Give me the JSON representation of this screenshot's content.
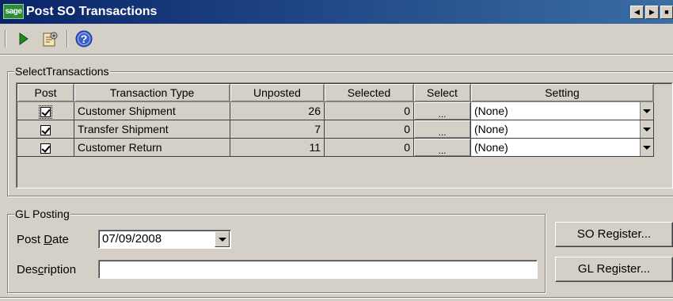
{
  "window": {
    "title": "Post SO Transactions",
    "logo": "sage",
    "controls": [
      "minimize",
      "maximize",
      "close"
    ]
  },
  "toolbar": {
    "items": [
      {
        "name": "run",
        "icon": "play-icon"
      },
      {
        "name": "setup",
        "icon": "setup-icon"
      },
      {
        "name": "help",
        "icon": "help-icon"
      }
    ]
  },
  "select_transactions": {
    "legend": "SelectTransactions",
    "columns": [
      "Post",
      "Transaction Type",
      "Unposted",
      "Selected",
      "Select",
      "Setting"
    ],
    "rows": [
      {
        "post": true,
        "type": "Customer Shipment",
        "unposted": "26",
        "selected": "0",
        "select": "...",
        "setting": "(None)"
      },
      {
        "post": true,
        "type": "Transfer Shipment",
        "unposted": "7",
        "selected": "0",
        "select": "...",
        "setting": "(None)"
      },
      {
        "post": true,
        "type": "Customer Return",
        "unposted": "11",
        "selected": "0",
        "select": "...",
        "setting": "(None)"
      }
    ]
  },
  "gl_posting": {
    "legend": "GL Posting",
    "post_date_label_pre": "Post ",
    "post_date_label_u": "D",
    "post_date_label_post": "ate",
    "post_date_value": "07/09/2008",
    "description_label_pre": "Des",
    "description_label_u": "c",
    "description_label_post": "ription",
    "description_value": ""
  },
  "buttons": {
    "so_register": "SO Register...",
    "gl_register": "GL Register..."
  },
  "colors": {
    "title_start": "#0a246a",
    "title_end": "#3a6ea5",
    "face": "#d4d0c8",
    "run_green": "#1f8a1f",
    "help_blue": "#3a5fcd"
  }
}
